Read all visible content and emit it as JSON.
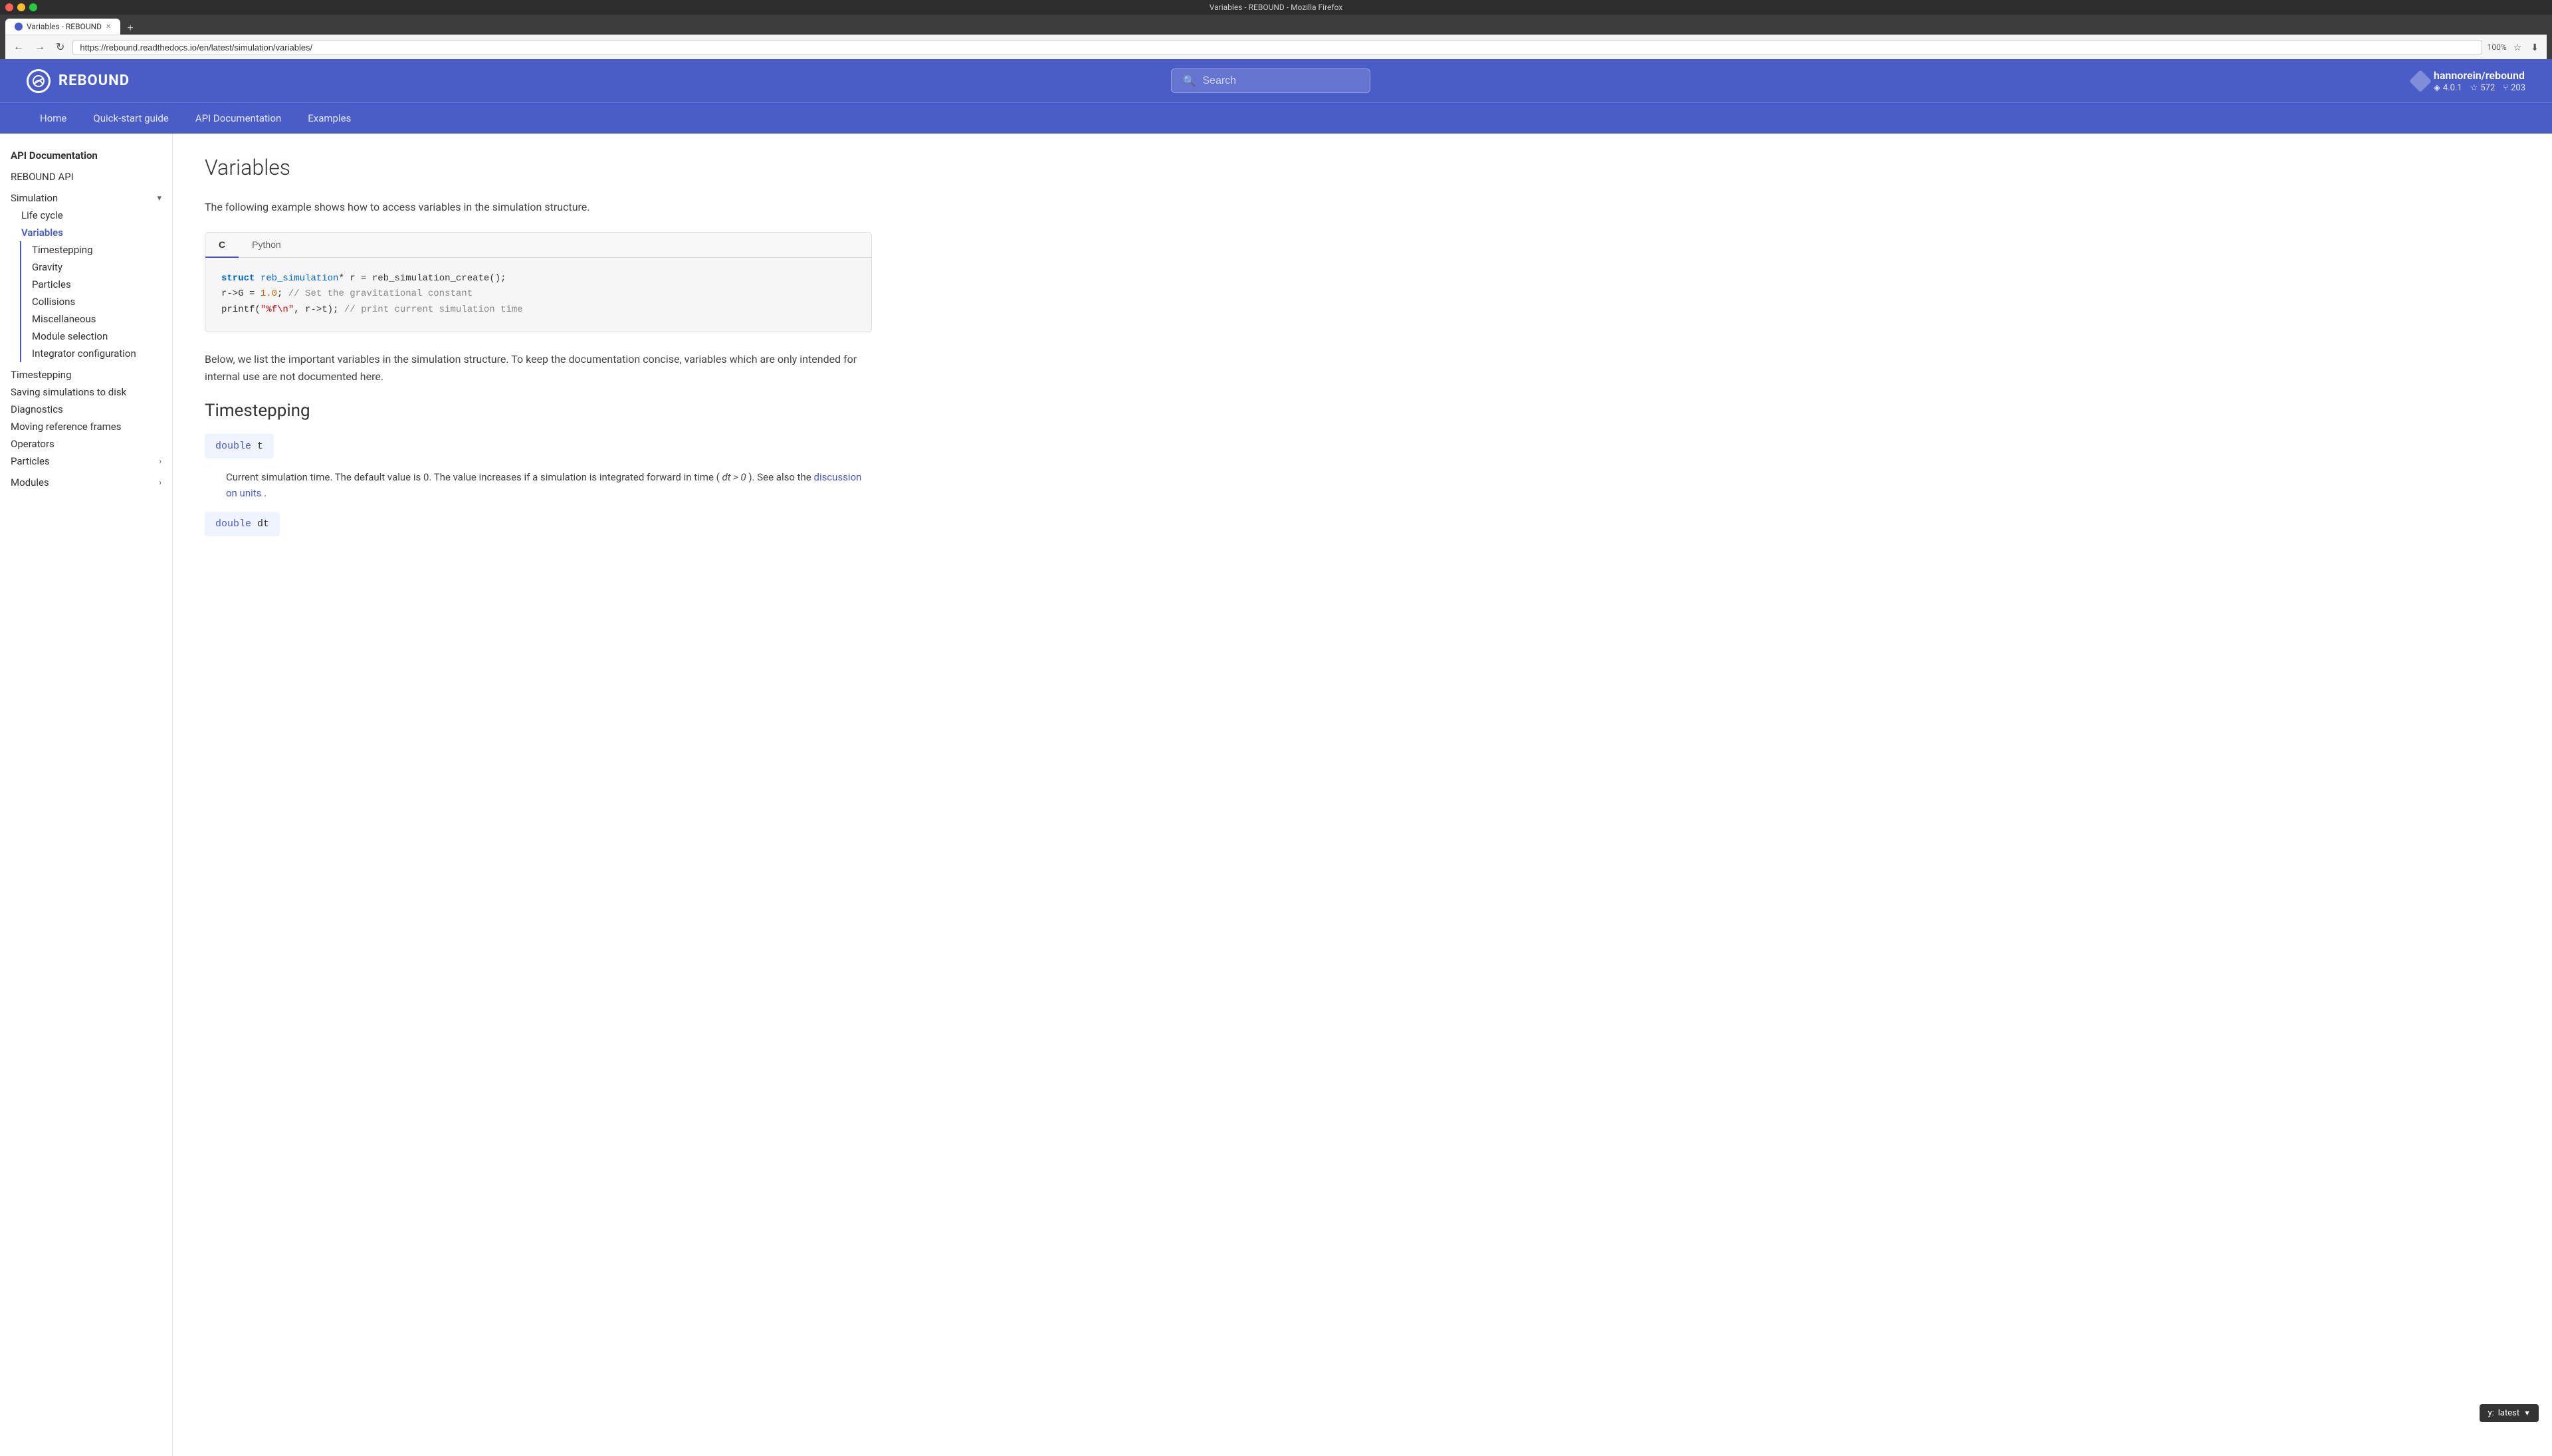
{
  "window": {
    "title": "Variables - REBOUND - Mozilla Firefox",
    "controls": [
      "close",
      "minimize",
      "maximize"
    ]
  },
  "browser": {
    "back_btn": "←",
    "forward_btn": "→",
    "reload_btn": "↻",
    "address": "https://rebound.readthedocs.io/en/latest/simulation/variables/",
    "zoom": "100%",
    "new_tab": "+"
  },
  "tabs": [
    {
      "label": "Variables - REBOUND",
      "active": true
    },
    {
      "label": "",
      "active": false
    }
  ],
  "header": {
    "logo_text": "REBOUND",
    "search_placeholder": "Search",
    "user": "hannorein/rebound",
    "version": "4.0.1",
    "stars": "572",
    "forks": "203"
  },
  "nav": {
    "items": [
      "Home",
      "Quick-start guide",
      "API Documentation",
      "Examples"
    ]
  },
  "sidebar": {
    "section_title": "API Documentation",
    "items": [
      {
        "label": "REBOUND API",
        "level": 0,
        "active": false
      },
      {
        "label": "Simulation",
        "level": 0,
        "expandable": true,
        "active": false
      },
      {
        "label": "Life cycle",
        "level": 1,
        "active": false
      },
      {
        "label": "Variables",
        "level": 1,
        "active": true
      },
      {
        "label": "Timestepping",
        "level": 2,
        "active": false
      },
      {
        "label": "Gravity",
        "level": 2,
        "active": false
      },
      {
        "label": "Particles",
        "level": 2,
        "active": false
      },
      {
        "label": "Collisions",
        "level": 2,
        "active": false
      },
      {
        "label": "Miscellaneous",
        "level": 2,
        "active": false
      },
      {
        "label": "Module selection",
        "level": 2,
        "active": false
      },
      {
        "label": "Integrator configuration",
        "level": 2,
        "active": false
      },
      {
        "label": "Timestepping",
        "level": 0,
        "active": false
      },
      {
        "label": "Saving simulations to disk",
        "level": 0,
        "active": false
      },
      {
        "label": "Diagnostics",
        "level": 0,
        "active": false
      },
      {
        "label": "Moving reference frames",
        "level": 0,
        "active": false
      },
      {
        "label": "Operators",
        "level": 0,
        "active": false
      },
      {
        "label": "Particles",
        "level": 0,
        "expandable": true,
        "active": false
      },
      {
        "label": "Modules",
        "level": 0,
        "expandable": true,
        "active": false
      }
    ]
  },
  "content": {
    "page_title": "Variables",
    "intro": "The following example shows how to access variables in the simulation structure.",
    "code_tabs": [
      "C",
      "Python"
    ],
    "active_tab": "C",
    "code_c": [
      "struct reb_simulation* r = reb_simulation_create();",
      "r->G = 1.0;              // Set the gravitational constant",
      "printf(\"%f\\n\", r->t);   // print current simulation time"
    ],
    "section_below": "Below, we list the important variables in the simulation structure. To keep the documentation concise, variables which are only intended for internal use are not documented here.",
    "timestepping_title": "Timestepping",
    "var_t_signature": "double t",
    "var_t_description": "Current simulation time. The default value is 0. The value increases if a simulation is integrated forward in time (",
    "var_t_math": "dt > 0",
    "var_t_description2": "). See also the",
    "var_t_link": "discussion on units",
    "var_t_description3": ".",
    "var_dt_signature": "double dt"
  },
  "version_badge": {
    "prefix": "y:",
    "version": "latest",
    "icon": "▼"
  }
}
